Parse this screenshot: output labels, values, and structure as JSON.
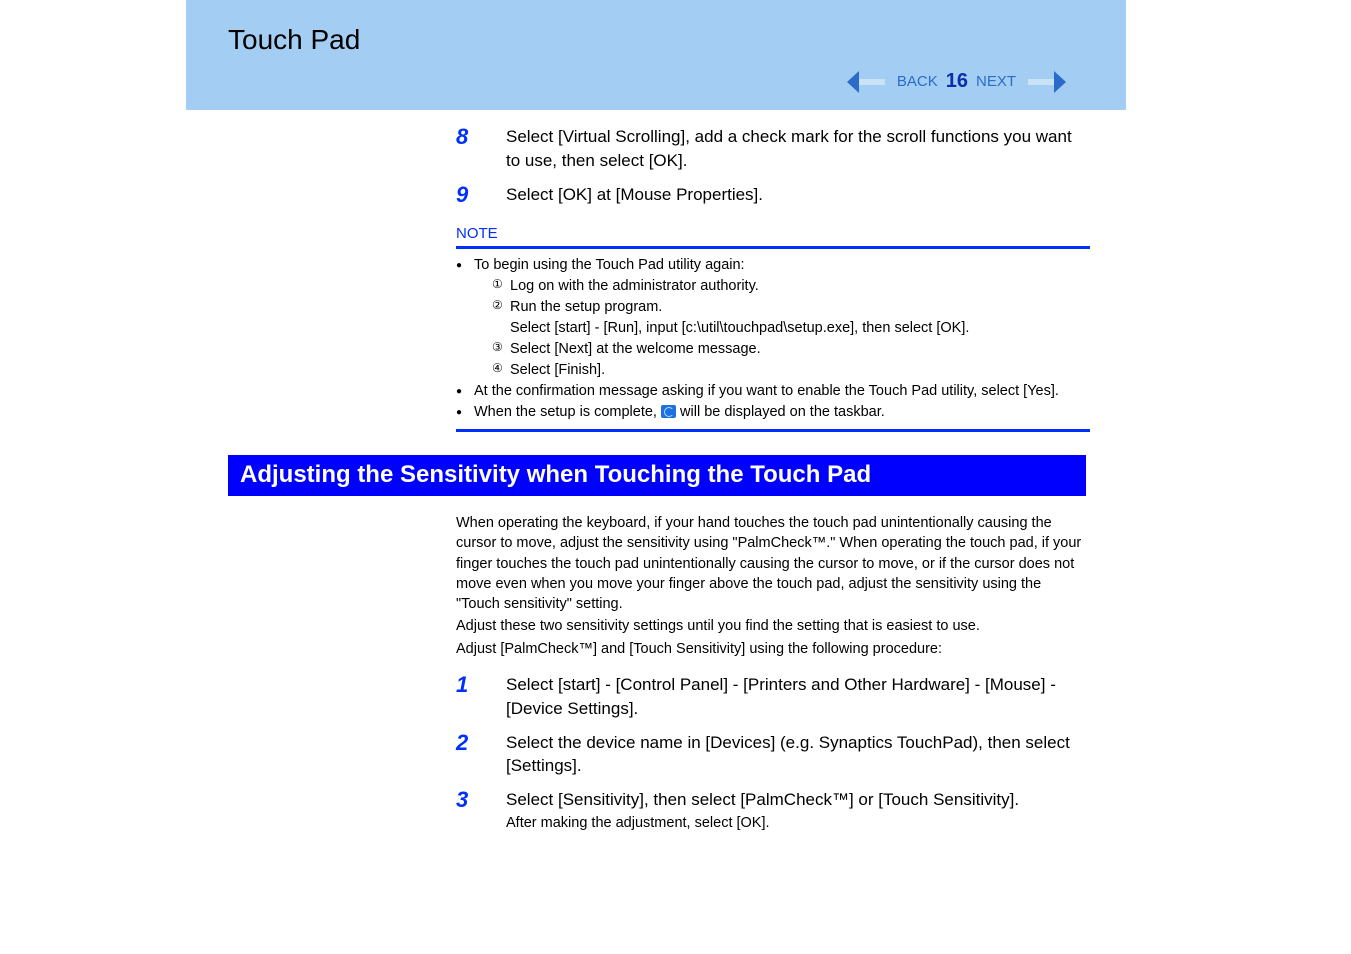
{
  "header": {
    "title": "Touch Pad",
    "nav": {
      "back": "BACK",
      "page": "16",
      "next": "NEXT"
    }
  },
  "top_steps": [
    {
      "num": "8",
      "body": "Select [Virtual Scrolling], add a check mark for the scroll functions you want to use, then select [OK]."
    },
    {
      "num": "9",
      "body": "Select [OK] at [Mouse Properties]."
    }
  ],
  "note": {
    "label": "NOTE",
    "b1": "To begin using the Touch Pad utility again:",
    "ol": [
      {
        "n": "①",
        "t": "Log on with the administrator authority."
      },
      {
        "n": "②",
        "t": "Run the setup program.",
        "sub": "Select [start] - [Run], input [c:\\util\\touchpad\\setup.exe], then select [OK]."
      },
      {
        "n": "③",
        "t": "Select [Next] at the welcome message."
      },
      {
        "n": "④",
        "t": "Select [Finish]."
      }
    ],
    "b2": "At the confirmation message asking if you want to enable the Touch Pad utility, select [Yes].",
    "b3_a": "When the setup is complete, ",
    "b3_b": " will be displayed on the taskbar."
  },
  "section_title": "Adjusting the Sensitivity when Touching the Touch Pad",
  "paras": {
    "p1": "When operating the keyboard, if your hand touches the touch pad unintentionally causing the cursor to move, adjust the sensitivity using \"PalmCheck™.\"  When operating the touch pad, if your finger touches the touch pad unintentionally causing the cursor to move, or if the cursor does not move even when you move your finger above the touch pad, adjust the sensitivity using the \"Touch sensitivity\" setting.",
    "p2": "Adjust these two sensitivity settings until you find the setting that is easiest to use.",
    "p3": "Adjust [PalmCheck™] and [Touch Sensitivity] using the following procedure:"
  },
  "bottom_steps": [
    {
      "num": "1",
      "body": "Select [start] - [Control Panel] - [Printers and Other Hardware] - [Mouse] - [Device Settings]."
    },
    {
      "num": "2",
      "body": "Select the device name in [Devices] (e.g. Synaptics TouchPad), then select [Settings]."
    },
    {
      "num": "3",
      "body": "Select [Sensitivity], then select [PalmCheck™] or [Touch Sensitivity].",
      "sub": "After making the adjustment, select [OK]."
    }
  ]
}
